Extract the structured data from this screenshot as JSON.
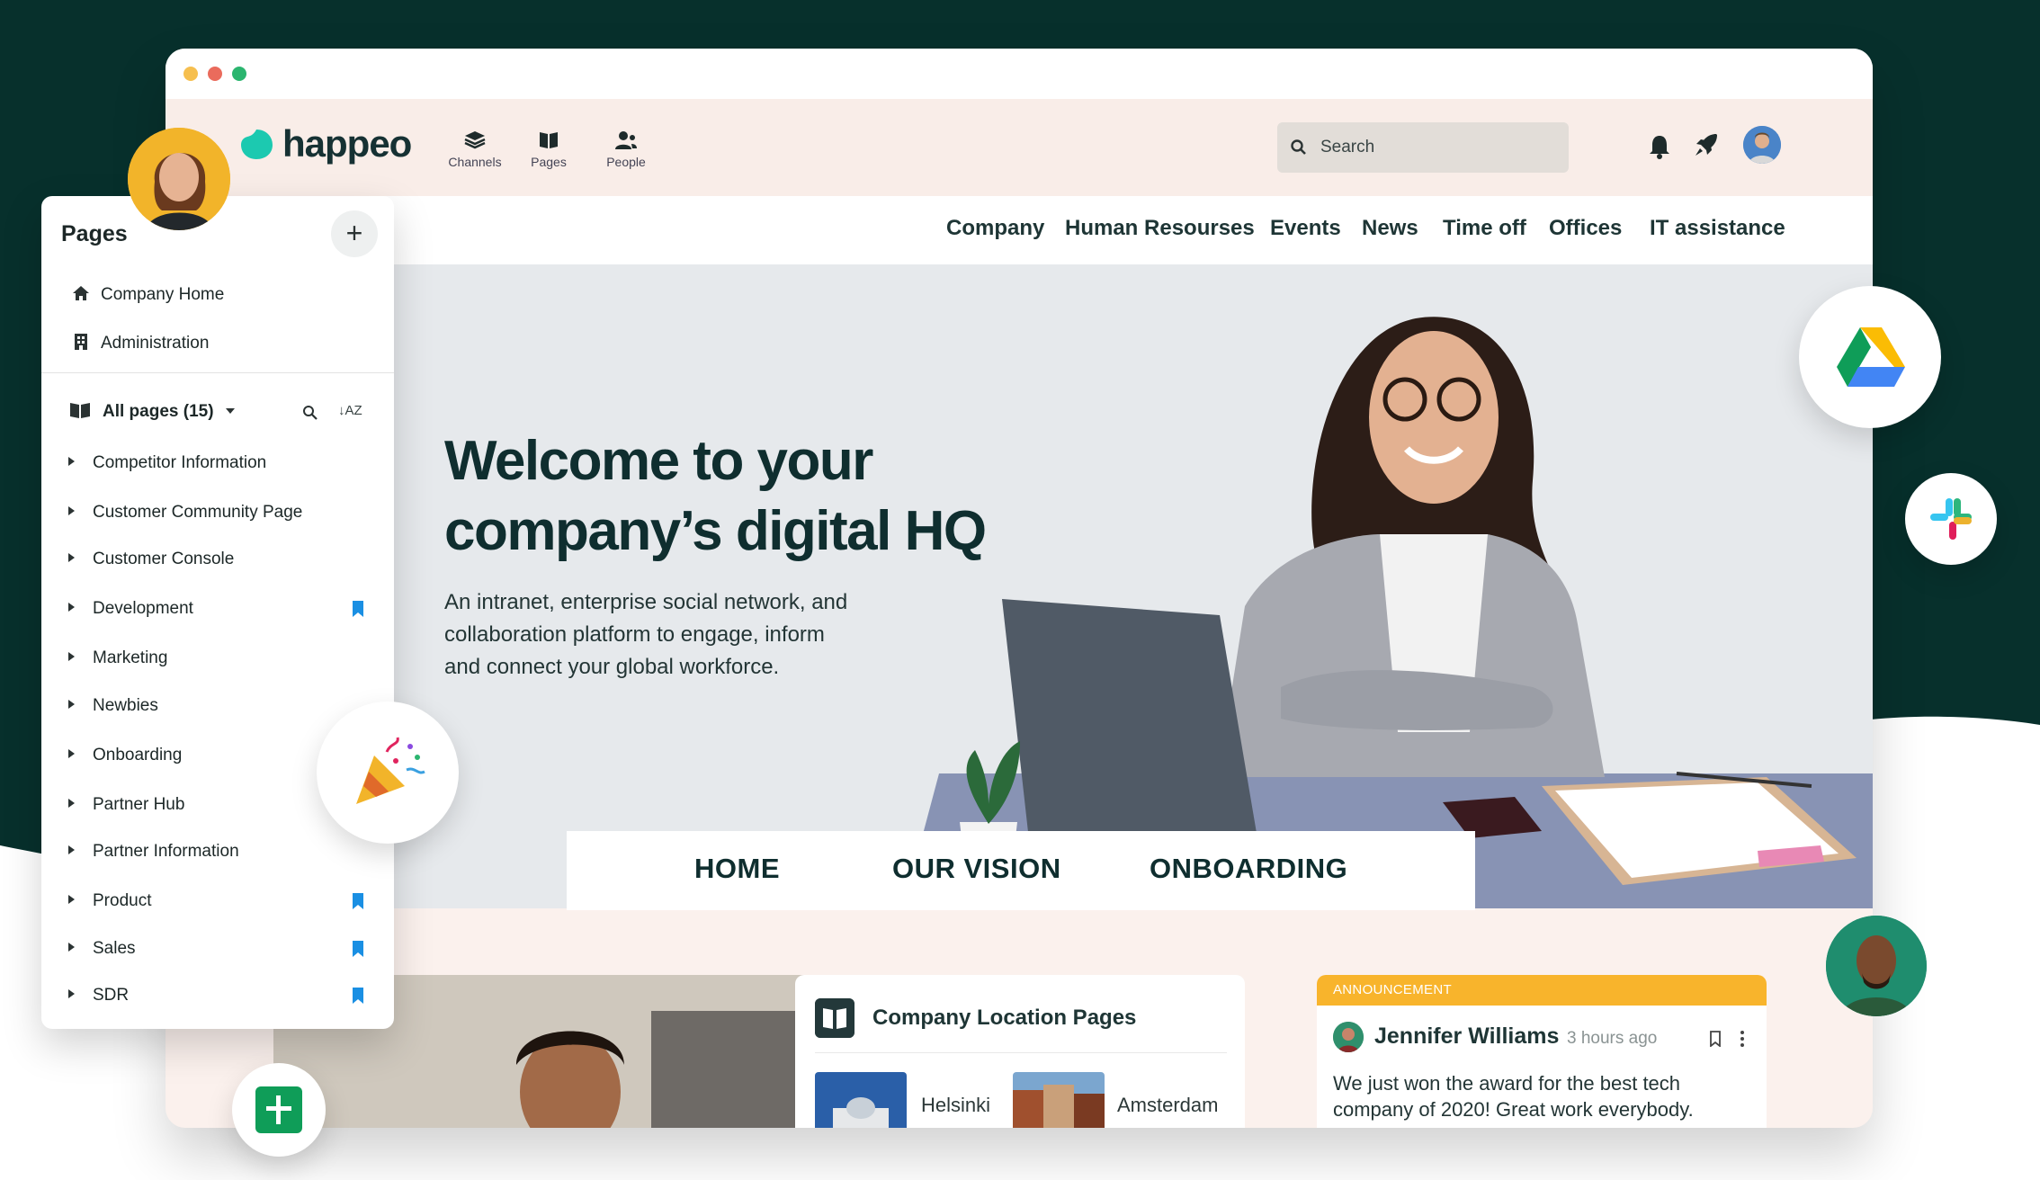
{
  "brand": {
    "name": "happeo",
    "accent": "#1cc9b0",
    "dark_bg": "#07302c"
  },
  "topnav": [
    {
      "label": "Channels",
      "icon": "layers-icon"
    },
    {
      "label": "Pages",
      "icon": "book-icon"
    },
    {
      "label": "People",
      "icon": "people-icon"
    }
  ],
  "search": {
    "placeholder": "Search"
  },
  "mainnav": [
    "Company",
    "Human Resourses",
    "Events",
    "News",
    "Time off",
    "Offices",
    "IT assistance"
  ],
  "hero": {
    "title_line1": "Welcome to your",
    "title_line2": "company’s digital HQ",
    "subtitle_line1": "An intranet, enterprise social network, and",
    "subtitle_line2": "collaboration platform to engage, inform",
    "subtitle_line3": "and connect your global workforce."
  },
  "tabs": [
    "HOME",
    "OUR VISION",
    "ONBOARDING"
  ],
  "location_card": {
    "title": "Company Location Pages",
    "locations": [
      "Helsinki",
      "Amsterdam"
    ]
  },
  "announcement": {
    "tag": "ANNOUNCEMENT",
    "author": "Jennifer Williams",
    "time": "3 hours ago",
    "message_line1": "We just won the award for the best tech",
    "message_line2": "company of 2020! Great work everybody."
  },
  "pages_panel": {
    "title": "Pages",
    "add_label": "+",
    "home": "Company Home",
    "admin": "Administration",
    "all_pages": "All pages (15)",
    "sort_label": "↓AZ",
    "items": [
      {
        "label": "Competitor Information",
        "bookmarked": false
      },
      {
        "label": "Customer Community Page",
        "bookmarked": false
      },
      {
        "label": "Customer Console",
        "bookmarked": false
      },
      {
        "label": "Development",
        "bookmarked": true
      },
      {
        "label": "Marketing",
        "bookmarked": false
      },
      {
        "label": "Newbies",
        "bookmarked": false
      },
      {
        "label": "Onboarding",
        "bookmarked": false
      },
      {
        "label": "Partner Hub",
        "bookmarked": false
      },
      {
        "label": "Partner Information",
        "bookmarked": false
      },
      {
        "label": "Product",
        "bookmarked": true
      },
      {
        "label": "Sales",
        "bookmarked": true
      },
      {
        "label": "SDR",
        "bookmarked": true
      }
    ]
  },
  "integrations": [
    "google-drive-icon",
    "slack-icon",
    "google-sheets-icon",
    "party-popper-icon"
  ]
}
